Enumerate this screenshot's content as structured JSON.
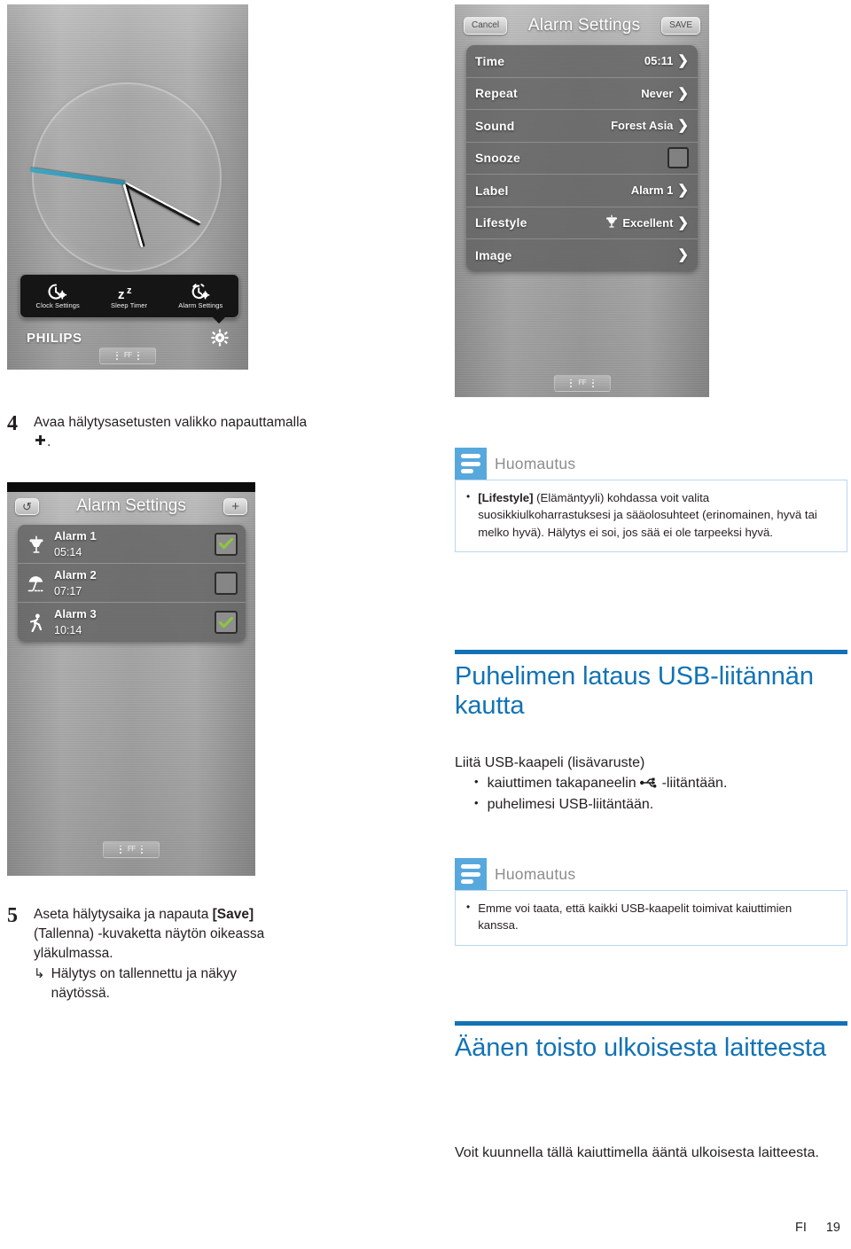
{
  "figures": {
    "clock": {
      "name": "clock-screen",
      "toolbar": [
        {
          "icon": "clock-gear-icon",
          "label": "Clock Settings"
        },
        {
          "icon": "sleep-zz-icon",
          "label": "Sleep Timer"
        },
        {
          "icon": "alarm-gear-icon",
          "label": "Alarm Settings"
        }
      ],
      "brand": "PHILIPS",
      "corner_icon": "gear-icon",
      "strip_label": "FF"
    },
    "alarm_detail": {
      "cancel_label": "Cancel",
      "title": "Alarm Settings",
      "save_label": "SAVE",
      "rows": [
        {
          "key": "Time",
          "value": "05:11",
          "type": "chevron",
          "icon": ""
        },
        {
          "key": "Repeat",
          "value": "Never",
          "type": "chevron",
          "icon": ""
        },
        {
          "key": "Sound",
          "value": "Forest Asia",
          "type": "chevron",
          "icon": ""
        },
        {
          "key": "Snooze",
          "value": "",
          "type": "checkbox-off",
          "icon": ""
        },
        {
          "key": "Label",
          "value": "Alarm 1",
          "type": "chevron",
          "icon": ""
        },
        {
          "key": "Lifestyle",
          "value": "Excellent",
          "type": "chevron",
          "icon": "grill-icon"
        },
        {
          "key": "Image",
          "value": "",
          "type": "chevron",
          "icon": ""
        }
      ]
    },
    "alarm_list": {
      "back_label": "↺",
      "title": "Alarm Settings",
      "add_label": "+",
      "items": [
        {
          "icon": "grill-icon",
          "name": "Alarm 1",
          "time": "05:14",
          "enabled": true
        },
        {
          "icon": "beach-umbrella-icon",
          "name": "Alarm 2",
          "time": "07:17",
          "enabled": false
        },
        {
          "icon": "running-person-icon",
          "name": "Alarm 3",
          "time": "10:14",
          "enabled": true
        }
      ]
    }
  },
  "steps": [
    {
      "number": "4",
      "text_before": "Avaa hälytysasetusten valikko napauttamalla",
      "glyph": "✚",
      "text_after": "."
    },
    {
      "number": "5",
      "line1_a": "Aseta hälytysaika ja napauta ",
      "line1_bold": "[Save]",
      "line1_b": "",
      "line2": "(Tallenna) -kuvaketta näytön oikeassa",
      "line3": "yläkulmassa.",
      "arrow": "↳",
      "sub": "Hälytys on tallennettu ja näkyy näytössä."
    }
  ],
  "notes": [
    {
      "title": "Huomautus",
      "bold_lead": "[Lifestyle]",
      "body": " (Elämäntyyli) kohdassa voit valita suosikkiulkoharrastuksesi ja sääolosuhteet (erinomainen, hyvä tai melko hyvä). Hälytys ei soi, jos sää ei ole tarpeeksi hyvä."
    },
    {
      "title": "Huomautus",
      "bold_lead": "",
      "body": "Emme voi taata, että kaikki USB-kaapelit toimivat kaiuttimien kanssa."
    }
  ],
  "sections": [
    {
      "heading": "Puhelimen lataus USB-liitännän kautta",
      "intro": "Liitä USB-kaapeli (lisävaruste)",
      "bullets": [
        {
          "before": "kaiuttimen takapaneelin ",
          "glyph": "usb-icon",
          "after": " -liitäntään."
        },
        {
          "before": "puhelimesi USB-liitäntään.",
          "glyph": "",
          "after": ""
        }
      ]
    },
    {
      "heading": "Äänen toisto ulkoisesta laitteesta",
      "intro": "Voit kuunnella tällä kaiuttimella ääntä ulkoisesta laitteesta.",
      "bullets": []
    }
  ],
  "footer": {
    "locale": "FI",
    "page": "19"
  },
  "colors": {
    "accent_blue": "#1272b5",
    "note_blue": "#57a8dd",
    "note_border": "#b9d8ee",
    "check_green": "#8dc63f"
  }
}
